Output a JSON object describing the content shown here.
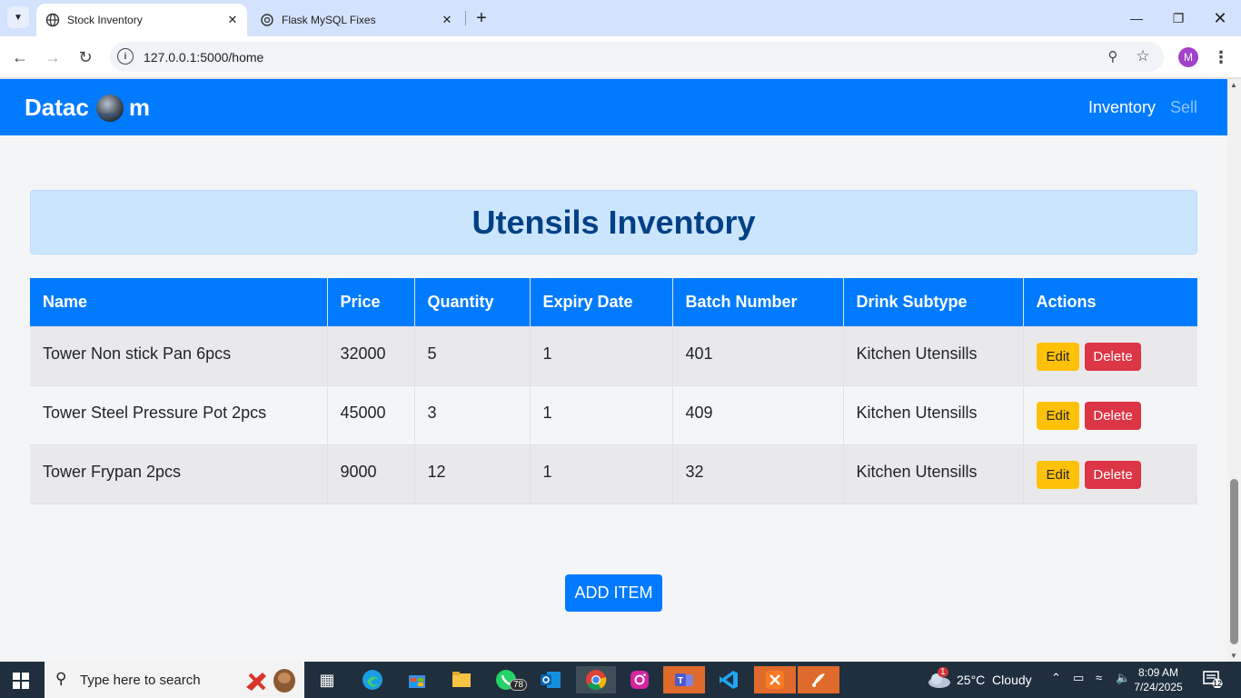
{
  "browser": {
    "tabs": [
      {
        "title": "Stock Inventory",
        "active": true
      },
      {
        "title": "Flask MySQL Fixes",
        "active": false
      }
    ],
    "url": "127.0.0.1:5000/home",
    "profile_initial": "M"
  },
  "navbar": {
    "brand_left": "Datac",
    "brand_right": "m",
    "logo_caption": "DataCom",
    "links": [
      "Inventory",
      "Sell"
    ]
  },
  "page": {
    "heading": "Utensils Inventory",
    "add_button": "ADD ITEM"
  },
  "table": {
    "headers": [
      "Name",
      "Price",
      "Quantity",
      "Expiry Date",
      "Batch Number",
      "Drink Subtype",
      "Actions"
    ],
    "rows": [
      {
        "name": "Tower Non stick Pan 6pcs",
        "price": "32000",
        "quantity": "5",
        "expiry": "1",
        "batch": "401",
        "subtype": "Kitchen Utensills",
        "edit": "Edit",
        "delete": "Delete"
      },
      {
        "name": "Tower Steel Pressure Pot 2pcs",
        "price": "45000",
        "quantity": "3",
        "expiry": "1",
        "batch": "409",
        "subtype": "Kitchen Utensills",
        "edit": "Edit",
        "delete": "Delete"
      },
      {
        "name": "Tower Frypan 2pcs",
        "price": "9000",
        "quantity": "12",
        "expiry": "1",
        "batch": "32",
        "subtype": "Kitchen Utensills",
        "edit": "Edit",
        "delete": "Delete"
      }
    ]
  },
  "taskbar": {
    "search_placeholder": "Type here to search",
    "whatsapp_badge": "78",
    "weather_badge": "1",
    "weather": "25°C  Cloudy",
    "time": "8:09 AM",
    "date": "7/24/2025",
    "notifications": "12"
  },
  "colors": {
    "primary": "#007bff",
    "heading_bg": "#cce5ff",
    "heading_text": "#004085",
    "edit": "#ffc107",
    "delete": "#dc3545"
  }
}
